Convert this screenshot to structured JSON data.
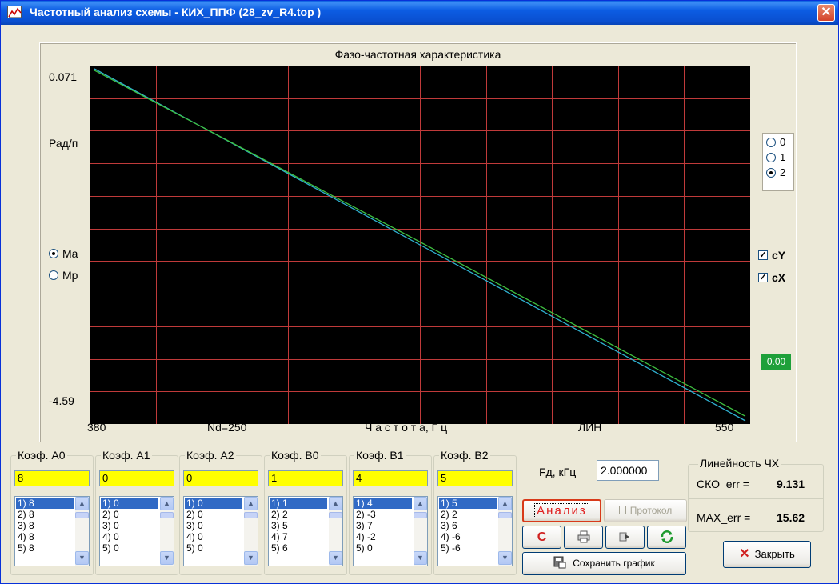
{
  "window": {
    "title": "Частотный анализ схемы  -  КИХ_ППФ (28_zv_R4.top )",
    "close_glyph": "✕"
  },
  "graph": {
    "title": "Фазо-частотная характеристика",
    "y_top": "0.071",
    "y_bottom": "-4.59",
    "y_unit": "Рад/п",
    "x_left": "380",
    "x_right": "550",
    "nd": "Nd=250",
    "x_label": "Ч а с т о т а,  Г ц",
    "scale": "ЛИН",
    "grid_color": "#c03a3a",
    "line_colors": [
      "#2fb0d0",
      "#3ec040"
    ]
  },
  "chart_data": {
    "type": "line",
    "xlim": [
      380,
      550
    ],
    "ylim": [
      -4.59,
      0.071
    ],
    "series": [
      {
        "color": "#2fb0d0",
        "x": [
          380,
          550
        ],
        "y": [
          0.071,
          -4.59
        ]
      },
      {
        "color": "#3ec040",
        "x": [
          380,
          465,
          550
        ],
        "y": [
          0.051,
          -2.22,
          -4.53
        ]
      }
    ]
  },
  "modes": {
    "ma": "Ma",
    "mp": "Mp",
    "selected": "ma"
  },
  "order_options": {
    "items": [
      "0",
      "1",
      "2"
    ],
    "selected": "2"
  },
  "checks": {
    "cy": "cY",
    "cx": "cX"
  },
  "green_value": "0.00",
  "coefs": [
    {
      "title": "Коэф. A0",
      "value": "8",
      "items": [
        "1) 8",
        "2) 8",
        "3) 8",
        "4) 8",
        "5) 8"
      ]
    },
    {
      "title": "Коэф. A1",
      "value": "0",
      "items": [
        "1) 0",
        "2) 0",
        "3) 0",
        "4) 0",
        "5) 0"
      ]
    },
    {
      "title": "Коэф. A2",
      "value": "0",
      "items": [
        "1) 0",
        "2) 0",
        "3) 0",
        "4) 0",
        "5) 0"
      ]
    },
    {
      "title": "Коэф. B0",
      "value": "1",
      "items": [
        "1) 1",
        "2) 2",
        "3) 5",
        "4) 7",
        "5) 6"
      ]
    },
    {
      "title": "Коэф. B1",
      "value": "4",
      "items": [
        "1) 4",
        "2) -3",
        "3) 7",
        "4) -2",
        "5) 0"
      ]
    },
    {
      "title": "Коэф. B2",
      "value": "5",
      "items": [
        "1) 5",
        "2) 2",
        "3) 6",
        "4) -6",
        "5) -6"
      ]
    }
  ],
  "fd": {
    "label": "Fд, кГц",
    "value": "2.000000"
  },
  "buttons": {
    "analiz": "Анализ",
    "protokol": "Протокол",
    "save": "Сохранить график",
    "close": "Закрыть"
  },
  "linearity": {
    "title": "Линейность ЧХ",
    "sko_label": "СКО_err =",
    "sko_value": "9.131",
    "max_label": "MAX_err =",
    "max_value": "15.62"
  }
}
